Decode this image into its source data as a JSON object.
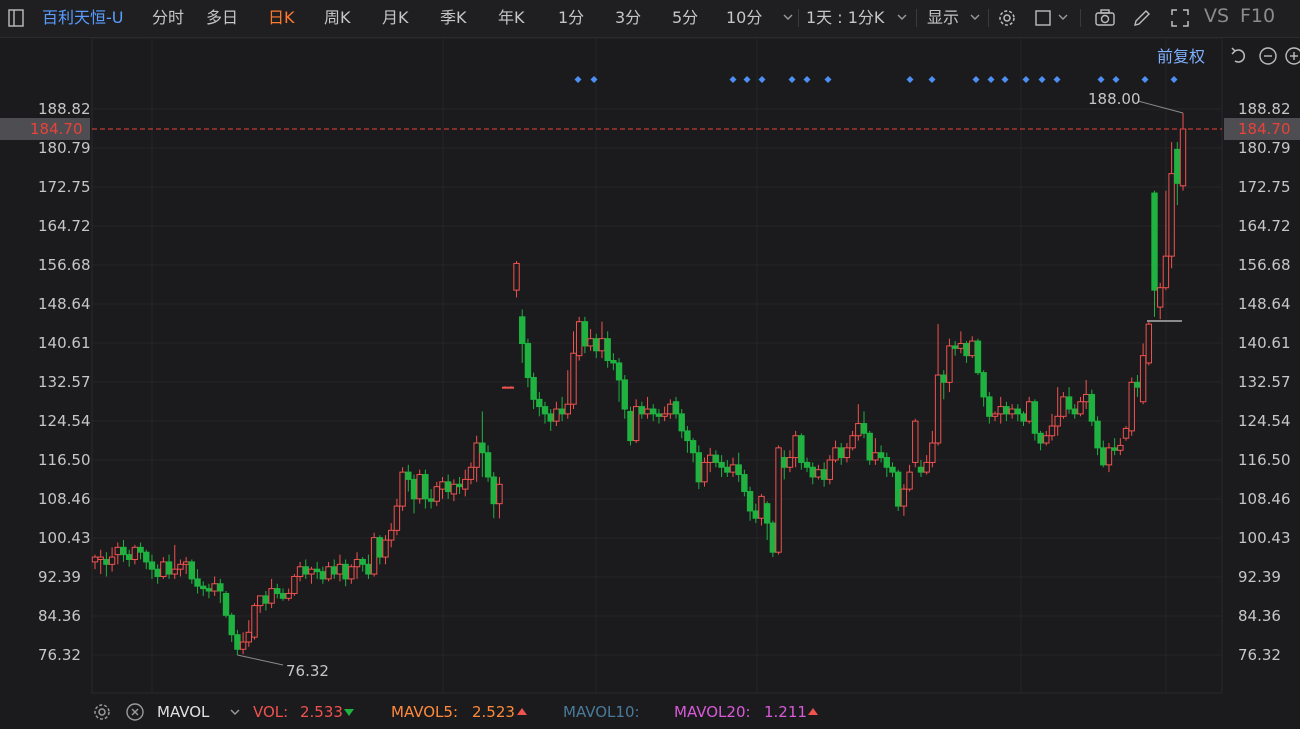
{
  "toolbar": {
    "stock_name": "百利天恒-U",
    "tabs": [
      "分时",
      "多日",
      "日K",
      "周K",
      "月K",
      "季K",
      "年K",
      "1分",
      "3分",
      "5分",
      "10分"
    ],
    "active_tab": "日K",
    "period_selector": "1天 : 1分K",
    "display_label": "显示",
    "vs_label": "VS",
    "f10_label": "F10"
  },
  "chart_controls": {
    "adjust_label": "前复权"
  },
  "colors": {
    "up": "#f0524f",
    "down": "#1fb241",
    "current_price": "#e8433a",
    "accent": "#ff7a2f",
    "link": "#5a9cff",
    "mavol5": "#ff8a3d",
    "mavol10": "#4a7a9a",
    "mavol20": "#d85ad8"
  },
  "chart_data": {
    "type": "candlestick",
    "title": "",
    "xlabel": "",
    "ylabel": "",
    "y_ticks": [
      "188.82",
      "180.79",
      "172.75",
      "164.72",
      "156.68",
      "148.64",
      "140.61",
      "132.57",
      "124.54",
      "116.50",
      "108.46",
      "100.43",
      "92.39",
      "84.36",
      "76.32"
    ],
    "ylim": [
      72.3,
      195.3
    ],
    "current_price": 184.7,
    "current_price_label": "184.70",
    "high_label": "188.00",
    "low_label": "76.32",
    "candles": [
      [
        95.5,
        96.5,
        94.0,
        97.0
      ],
      [
        96.0,
        96.5,
        93.0,
        98.0
      ],
      [
        96.0,
        95.0,
        92.5,
        97.5
      ],
      [
        95.0,
        96.5,
        93.5,
        98.5
      ],
      [
        97.0,
        98.5,
        95.0,
        99.5
      ],
      [
        98.5,
        97.0,
        95.5,
        100.0
      ],
      [
        97.0,
        96.0,
        94.5,
        98.0
      ],
      [
        96.0,
        98.5,
        95.0,
        99.0
      ],
      [
        98.5,
        97.5,
        96.0,
        99.5
      ],
      [
        97.5,
        95.5,
        94.0,
        98.0
      ],
      [
        95.5,
        94.0,
        92.0,
        97.0
      ],
      [
        94.0,
        92.5,
        91.0,
        95.0
      ],
      [
        92.5,
        95.5,
        92.0,
        96.5
      ],
      [
        95.5,
        93.0,
        92.0,
        97.0
      ],
      [
        93.0,
        94.0,
        92.0,
        99.0
      ],
      [
        94.0,
        95.0,
        92.5,
        96.0
      ],
      [
        95.0,
        95.5,
        93.0,
        96.5
      ],
      [
        95.5,
        92.0,
        91.0,
        96.0
      ],
      [
        92.0,
        90.5,
        89.0,
        94.0
      ],
      [
        90.5,
        90.0,
        88.5,
        91.5
      ],
      [
        90.0,
        89.5,
        88.0,
        91.0
      ],
      [
        89.5,
        91.0,
        88.5,
        92.5
      ],
      [
        91.0,
        89.5,
        87.0,
        92.0
      ],
      [
        89.0,
        84.5,
        84.0,
        89.5
      ],
      [
        84.5,
        80.5,
        79.0,
        85.0
      ],
      [
        80.5,
        77.5,
        76.32,
        81.5
      ],
      [
        77.5,
        79.0,
        76.5,
        81.0
      ],
      [
        79.0,
        81.0,
        78.0,
        83.5
      ],
      [
        80.0,
        86.5,
        79.5,
        87.0
      ],
      [
        86.5,
        88.5,
        85.0,
        88.5
      ],
      [
        88.5,
        87.0,
        85.5,
        89.5
      ],
      [
        87.0,
        90.0,
        86.0,
        92.0
      ],
      [
        90.0,
        89.0,
        88.0,
        91.0
      ],
      [
        89.0,
        88.0,
        87.5,
        90.0
      ],
      [
        88.0,
        89.0,
        87.5,
        90.0
      ],
      [
        89.0,
        92.5,
        88.5,
        93.0
      ],
      [
        92.5,
        94.5,
        91.5,
        95.5
      ],
      [
        94.5,
        93.0,
        92.0,
        96.0
      ],
      [
        93.0,
        94.0,
        91.0,
        94.5
      ],
      [
        94.0,
        93.5,
        92.0,
        95.5
      ],
      [
        93.5,
        92.0,
        91.0,
        94.5
      ],
      [
        92.0,
        94.5,
        91.5,
        95.5
      ],
      [
        94.5,
        93.0,
        92.0,
        96.0
      ],
      [
        93.0,
        95.0,
        91.5,
        97.0
      ],
      [
        95.0,
        92.0,
        90.5,
        96.0
      ],
      [
        92.0,
        94.5,
        91.0,
        95.0
      ],
      [
        94.5,
        96.0,
        92.0,
        97.5
      ],
      [
        96.0,
        95.0,
        93.5,
        96.5
      ],
      [
        95.0,
        93.0,
        92.0,
        97.0
      ],
      [
        93.0,
        100.5,
        92.5,
        101.5
      ],
      [
        100.5,
        96.5,
        95.0,
        101.0
      ],
      [
        96.5,
        100.0,
        95.0,
        101.0
      ],
      [
        100.0,
        102.0,
        98.5,
        103.5
      ],
      [
        102.0,
        107.0,
        101.0,
        108.5
      ],
      [
        107.0,
        114.0,
        106.0,
        115.0
      ],
      [
        114.0,
        112.5,
        110.0,
        115.5
      ],
      [
        112.5,
        108.5,
        105.5,
        113.5
      ],
      [
        108.5,
        113.5,
        107.5,
        114.5
      ],
      [
        113.5,
        108.5,
        106.5,
        114.5
      ],
      [
        108.5,
        108.0,
        106.5,
        110.5
      ],
      [
        108.0,
        111.0,
        107.0,
        112.0
      ],
      [
        110.5,
        112.0,
        108.5,
        113.0
      ],
      [
        112.0,
        110.0,
        108.5,
        113.5
      ],
      [
        109.5,
        111.5,
        108.0,
        112.5
      ],
      [
        111.5,
        111.0,
        109.5,
        113.0
      ],
      [
        110.5,
        112.5,
        109.0,
        114.5
      ],
      [
        112.5,
        115.0,
        111.5,
        116.0
      ],
      [
        115.0,
        120.0,
        112.0,
        121.5
      ],
      [
        120.0,
        118.0,
        113.0,
        126.5
      ],
      [
        118.0,
        113.0,
        112.0,
        119.5
      ],
      [
        113.0,
        107.5,
        104.5,
        114.0
      ],
      [
        107.5,
        111.5,
        104.5,
        113.0
      ],
      [
        131.5,
        131.5,
        131.3,
        131.7
      ],
      [
        131.5,
        131.5,
        131.3,
        131.7
      ],
      [
        151.5,
        157.0,
        150.0,
        157.5
      ],
      [
        146.0,
        140.5,
        136.5,
        147.5
      ],
      [
        140.5,
        133.5,
        131.5,
        141.5
      ],
      [
        133.5,
        129.0,
        127.0,
        134.5
      ],
      [
        129.0,
        127.5,
        125.5,
        130.5
      ],
      [
        127.5,
        126.0,
        124.0,
        128.5
      ],
      [
        126.0,
        124.5,
        122.5,
        127.0
      ],
      [
        124.5,
        127.0,
        123.5,
        128.5
      ],
      [
        127.0,
        126.0,
        124.5,
        129.5
      ],
      [
        126.0,
        128.0,
        125.0,
        135.0
      ],
      [
        128.0,
        138.5,
        127.0,
        143.0
      ],
      [
        138.0,
        145.0,
        137.0,
        146.0
      ],
      [
        145.0,
        140.0,
        138.5,
        146.0
      ],
      [
        140.0,
        141.5,
        139.0,
        143.5
      ],
      [
        141.5,
        139.0,
        137.5,
        142.5
      ],
      [
        139.0,
        141.5,
        137.5,
        145.0
      ],
      [
        141.5,
        137.0,
        135.5,
        143.0
      ],
      [
        137.0,
        136.5,
        135.0,
        138.5
      ],
      [
        136.5,
        133.0,
        128.5,
        137.5
      ],
      [
        133.0,
        127.0,
        125.0,
        134.0
      ],
      [
        126.5,
        120.5,
        119.5,
        127.5
      ],
      [
        120.5,
        127.5,
        120.0,
        129.0
      ],
      [
        127.5,
        126.0,
        125.0,
        128.5
      ],
      [
        126.0,
        127.0,
        125.0,
        129.5
      ],
      [
        127.0,
        126.0,
        124.5,
        128.0
      ],
      [
        126.0,
        125.5,
        124.0,
        127.0
      ],
      [
        125.5,
        126.0,
        124.5,
        127.5
      ],
      [
        126.0,
        128.0,
        125.0,
        129.0
      ],
      [
        128.5,
        126.0,
        125.0,
        129.5
      ],
      [
        126.0,
        122.5,
        121.0,
        127.0
      ],
      [
        122.5,
        120.5,
        118.0,
        123.5
      ],
      [
        120.5,
        118.0,
        116.0,
        121.0
      ],
      [
        118.0,
        112.0,
        110.5,
        119.5
      ],
      [
        112.0,
        116.0,
        111.0,
        117.0
      ],
      [
        116.0,
        117.5,
        114.0,
        119.0
      ],
      [
        117.5,
        116.0,
        115.0,
        118.5
      ],
      [
        116.0,
        115.0,
        113.0,
        117.5
      ],
      [
        115.0,
        114.0,
        113.0,
        116.5
      ],
      [
        114.0,
        115.5,
        113.0,
        117.0
      ],
      [
        115.5,
        113.5,
        112.0,
        118.0
      ],
      [
        113.5,
        110.0,
        109.0,
        114.5
      ],
      [
        110.0,
        106.0,
        104.0,
        111.0
      ],
      [
        106.0,
        104.5,
        103.5,
        107.5
      ],
      [
        104.5,
        109.0,
        103.0,
        109.5
      ],
      [
        107.5,
        103.5,
        100.0,
        108.0
      ],
      [
        103.5,
        97.5,
        96.5,
        104.0
      ],
      [
        97.5,
        119.0,
        97.0,
        119.5
      ],
      [
        117.0,
        115.0,
        112.5,
        118.5
      ],
      [
        115.0,
        117.0,
        114.0,
        118.5
      ],
      [
        117.0,
        121.5,
        115.0,
        122.5
      ],
      [
        121.5,
        116.0,
        114.5,
        122.0
      ],
      [
        116.0,
        115.0,
        114.0,
        117.0
      ],
      [
        115.0,
        113.0,
        111.5,
        116.0
      ],
      [
        113.0,
        114.5,
        112.5,
        115.5
      ],
      [
        114.5,
        112.5,
        111.0,
        116.0
      ],
      [
        112.5,
        116.5,
        111.5,
        117.5
      ],
      [
        116.5,
        119.0,
        116.0,
        120.5
      ],
      [
        119.0,
        117.0,
        115.5,
        120.0
      ],
      [
        117.0,
        119.0,
        116.0,
        120.0
      ],
      [
        119.0,
        121.5,
        118.5,
        122.5
      ],
      [
        121.5,
        124.0,
        120.5,
        128.0
      ],
      [
        124.0,
        122.0,
        121.0,
        126.5
      ],
      [
        122.0,
        116.5,
        115.5,
        122.5
      ],
      [
        116.5,
        118.0,
        115.5,
        121.0
      ],
      [
        118.0,
        117.0,
        116.0,
        119.5
      ],
      [
        117.0,
        115.0,
        113.0,
        118.0
      ],
      [
        115.0,
        114.0,
        113.0,
        116.0
      ],
      [
        114.0,
        107.0,
        106.0,
        114.5
      ],
      [
        107.0,
        110.5,
        105.0,
        111.5
      ],
      [
        110.5,
        114.0,
        110.0,
        115.5
      ],
      [
        116.0,
        124.5,
        115.0,
        125.0
      ],
      [
        115.0,
        114.0,
        113.0,
        116.5
      ],
      [
        114.0,
        116.0,
        113.5,
        117.5
      ],
      [
        116.0,
        120.0,
        115.0,
        122.5
      ],
      [
        120.0,
        134.0,
        119.5,
        144.5
      ],
      [
        134.0,
        132.5,
        129.0,
        135.0
      ],
      [
        132.5,
        140.0,
        130.5,
        141.5
      ],
      [
        140.0,
        139.5,
        138.0,
        141.0
      ],
      [
        139.5,
        140.5,
        138.5,
        143.0
      ],
      [
        140.5,
        138.0,
        136.5,
        141.0
      ],
      [
        138.0,
        141.0,
        137.5,
        142.0
      ],
      [
        141.0,
        134.5,
        134.0,
        141.5
      ],
      [
        134.5,
        129.5,
        127.5,
        135.0
      ],
      [
        129.5,
        125.5,
        124.0,
        130.5
      ],
      [
        125.5,
        126.0,
        124.5,
        126.5
      ],
      [
        126.0,
        127.5,
        124.0,
        129.5
      ],
      [
        127.5,
        126.0,
        124.5,
        128.5
      ],
      [
        126.0,
        127.0,
        125.0,
        128.0
      ],
      [
        127.0,
        126.0,
        124.5,
        128.0
      ],
      [
        126.0,
        124.5,
        123.5,
        126.5
      ],
      [
        124.5,
        128.5,
        124.0,
        129.5
      ],
      [
        128.5,
        122.0,
        120.5,
        129.0
      ],
      [
        122.0,
        120.0,
        118.5,
        122.5
      ],
      [
        120.0,
        121.5,
        119.5,
        122.5
      ],
      [
        121.5,
        123.5,
        120.5,
        126.0
      ],
      [
        123.5,
        125.5,
        121.5,
        131.5
      ],
      [
        125.5,
        129.5,
        125.0,
        130.5
      ],
      [
        129.5,
        127.0,
        126.0,
        131.5
      ],
      [
        127.0,
        126.0,
        125.0,
        128.0
      ],
      [
        126.0,
        128.5,
        125.5,
        129.5
      ],
      [
        128.5,
        130.0,
        127.0,
        133.0
      ],
      [
        130.0,
        124.5,
        123.5,
        131.0
      ],
      [
        124.5,
        119.0,
        117.5,
        125.5
      ],
      [
        119.0,
        115.5,
        115.0,
        120.5
      ],
      [
        115.5,
        119.0,
        114.0,
        120.0
      ],
      [
        119.0,
        118.5,
        117.5,
        121.0
      ],
      [
        118.5,
        119.5,
        117.5,
        121.0
      ],
      [
        121.0,
        123.0,
        120.5,
        123.5
      ],
      [
        122.5,
        132.5,
        121.5,
        133.5
      ],
      [
        132.5,
        131.5,
        129.5,
        134.0
      ],
      [
        128.5,
        138.0,
        128.0,
        140.5
      ],
      [
        136.5,
        144.5,
        136.0,
        145.0
      ],
      [
        171.5,
        151.5,
        146.0,
        172.0
      ],
      [
        148.0,
        152.0,
        145.5,
        153.0
      ],
      [
        152.0,
        158.5,
        151.5,
        172.0
      ],
      [
        158.5,
        175.5,
        156.0,
        182.0
      ],
      [
        180.5,
        173.5,
        169.0,
        182.0
      ],
      [
        173.0,
        184.7,
        172.0,
        188.0
      ]
    ],
    "mavol": {
      "label": "MAVOL",
      "vol_label": "VOL:",
      "vol_value": "2.533",
      "ma5_label": "MAVOL5:",
      "ma5_value": "2.523",
      "ma10_label": "MAVOL10:",
      "ma10_value": "",
      "ma20_label": "MAVOL20:",
      "ma20_value": "1.211"
    }
  }
}
